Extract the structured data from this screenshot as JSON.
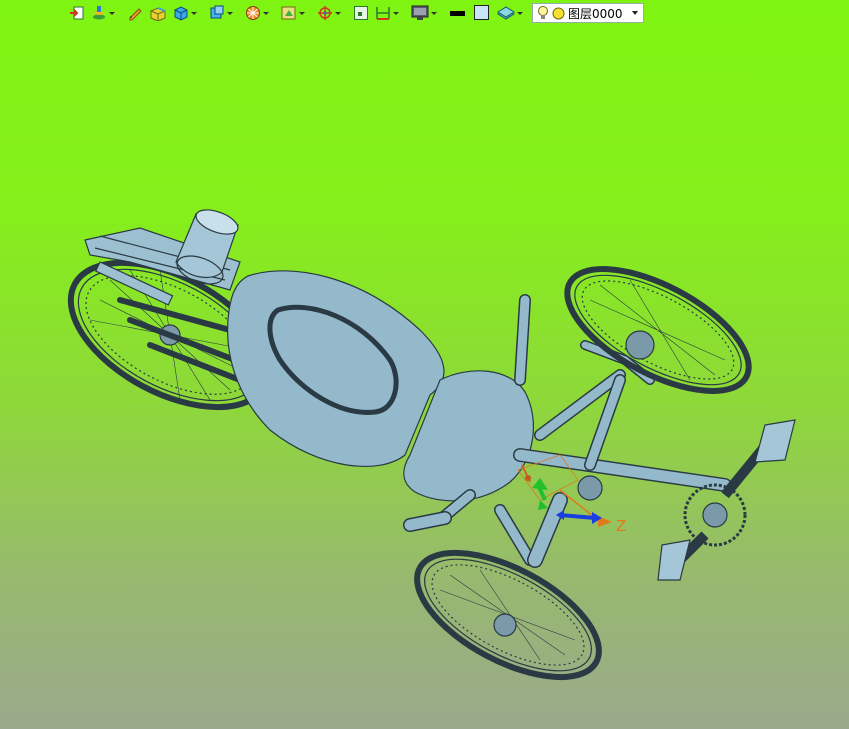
{
  "toolbar": {
    "buttons": [
      {
        "icon": "import-icon",
        "dropdown": false
      },
      {
        "icon": "layers-stack-icon",
        "dropdown": true
      },
      {
        "icon": "pencil-icon",
        "dropdown": false
      },
      {
        "icon": "box-edit-icon",
        "dropdown": false
      },
      {
        "icon": "solid-cube-icon",
        "dropdown": true
      },
      {
        "icon": "view-cube-icon",
        "dropdown": true
      },
      {
        "icon": "render-sphere-icon",
        "dropdown": true
      },
      {
        "icon": "view-orient-icon",
        "dropdown": true
      },
      {
        "icon": "snap-target-icon",
        "dropdown": true
      },
      {
        "icon": "fit-window-icon",
        "dropdown": false
      },
      {
        "icon": "dimension-icon",
        "dropdown": true
      },
      {
        "icon": "display-mode-icon",
        "dropdown": true
      },
      {
        "icon": "line-color-icon",
        "dropdown": false
      },
      {
        "icon": "fill-color-icon",
        "dropdown": false
      },
      {
        "icon": "layer-plane-icon",
        "dropdown": true
      }
    ],
    "layer": {
      "value": "图层0000"
    }
  },
  "viewport": {
    "triad_axis_label": "Z",
    "colors": {
      "part": "#8fb3c4",
      "edge": "#2a3a44",
      "axis_z": "#e07a1a",
      "axis_green": "#22c02a",
      "axis_blue": "#1a3fe0"
    }
  }
}
